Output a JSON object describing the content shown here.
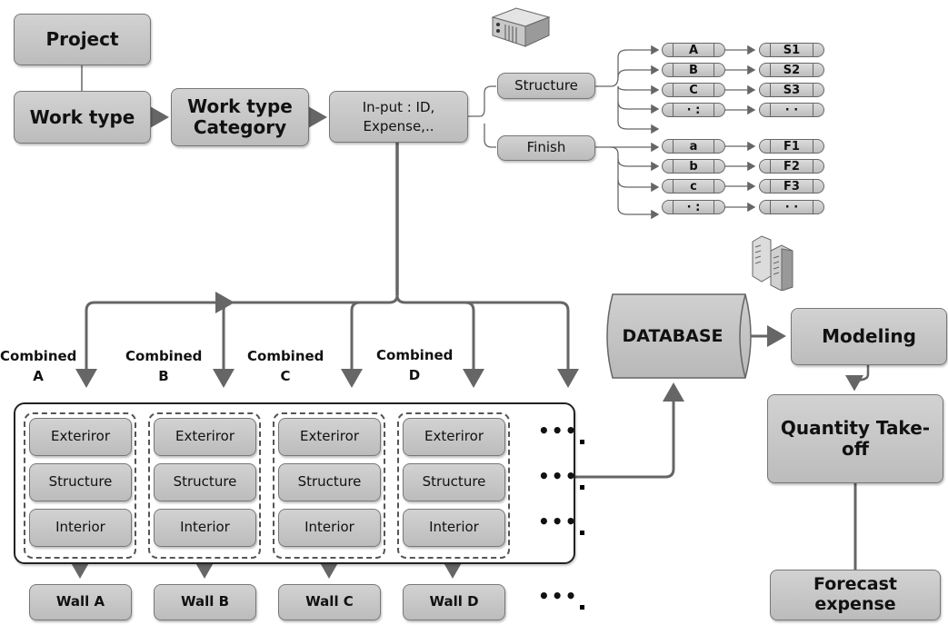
{
  "nodes": {
    "project": "Project",
    "work_type": "Work type",
    "work_type_category": "Work type Category",
    "input": "In-put : ID, Expense,..",
    "structure": "Structure",
    "finish": "Finish",
    "database": "DATABASE",
    "modeling": "Modeling",
    "quantity_takeoff": "Quantity Take-off",
    "forecast_expense": "Forecast expense"
  },
  "structure_items": [
    {
      "from": "A",
      "to": "S1"
    },
    {
      "from": "B",
      "to": "S2"
    },
    {
      "from": "C",
      "to": "S3"
    },
    {
      "from": "· :",
      "to": "· ·"
    }
  ],
  "finish_items": [
    {
      "from": "a",
      "to": "F1"
    },
    {
      "from": "b",
      "to": "F2"
    },
    {
      "from": "c",
      "to": "F3"
    },
    {
      "from": "· :",
      "to": "· ·"
    }
  ],
  "combined": [
    {
      "label": "Combined A",
      "layers": [
        "Exteriror",
        "Structure",
        "Interior"
      ],
      "wall": "Wall A"
    },
    {
      "label": "Combined B",
      "layers": [
        "Exteriror",
        "Structure",
        "Interior"
      ],
      "wall": "Wall B"
    },
    {
      "label": "Combined C",
      "layers": [
        "Exteriror",
        "Structure",
        "Interior"
      ],
      "wall": "Wall C"
    },
    {
      "label": "Combined D",
      "layers": [
        "Exteriror",
        "Structure",
        "Interior"
      ],
      "wall": "Wall D"
    }
  ],
  "ellipsis": "•••",
  "icons": [
    "server-icon",
    "building-icon"
  ]
}
